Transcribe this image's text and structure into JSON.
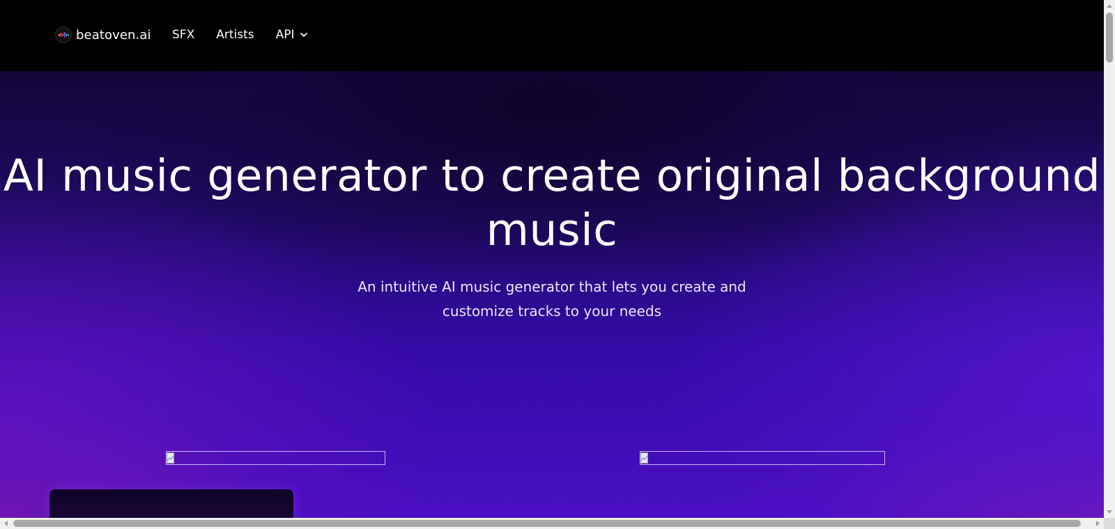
{
  "brand": {
    "name": "beatoven.ai",
    "logo_icon": "beatoven-logo-icon"
  },
  "nav": {
    "items": [
      {
        "label": "SFX"
      },
      {
        "label": "Artists"
      },
      {
        "label": "API",
        "icon": "chevron-down-icon"
      }
    ]
  },
  "hero": {
    "title": "AI music generator to create original background music",
    "subtitle": "An intuitive AI music generator that lets you create and customize tracks to your needs"
  },
  "colors": {
    "header_bg": "#000000",
    "hero_gradient_top": "#12063a",
    "hero_gradient_bottom": "#4a0ec4",
    "text": "#ffffff"
  }
}
